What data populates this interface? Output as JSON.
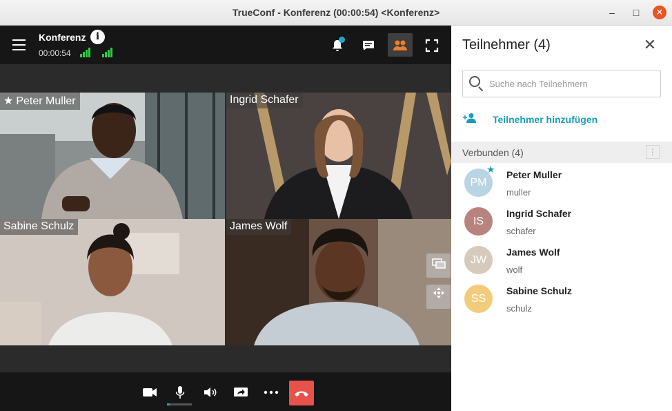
{
  "window": {
    "title": "TrueConf - Konferenz (00:00:54) <Konferenz>"
  },
  "conference": {
    "name": "Konferenz",
    "timer": "00:00:54"
  },
  "toolbar": {
    "menu_icon": "hamburger-icon",
    "info_icon": "i",
    "icons": [
      "bell-icon",
      "chat-icon",
      "people-icon",
      "fullscreen-icon"
    ],
    "accent": "#f07f2a"
  },
  "tiles": [
    {
      "name": "Peter Muller",
      "owner": true
    },
    {
      "name": "Ingrid Schafer"
    },
    {
      "name": "Sabine Schulz"
    },
    {
      "name": "James Wolf"
    }
  ],
  "controls": [
    "camera-icon",
    "microphone-icon",
    "speaker-icon",
    "share-screen-icon",
    "more-icon",
    "hangup-icon"
  ],
  "panel": {
    "title": "Teilnehmer (4)",
    "search_placeholder": "Suche nach Teilnehmern",
    "add_label": "Teilnehmer hinzufügen",
    "group_label": "Verbunden (4)",
    "accent": "#1a9db8",
    "participants": [
      {
        "initials": "PM",
        "name": "Peter Muller",
        "login": "muller",
        "color": "#b9d4e3"
      },
      {
        "initials": "IS",
        "name": "Ingrid Schafer",
        "login": "schafer",
        "color": "#b8837f"
      },
      {
        "initials": "JW",
        "name": "James Wolf",
        "login": "wolf",
        "color": "#d6cabd"
      },
      {
        "initials": "SS",
        "name": "Sabine Schulz",
        "login": "schulz",
        "color": "#f2cc7a"
      }
    ]
  }
}
